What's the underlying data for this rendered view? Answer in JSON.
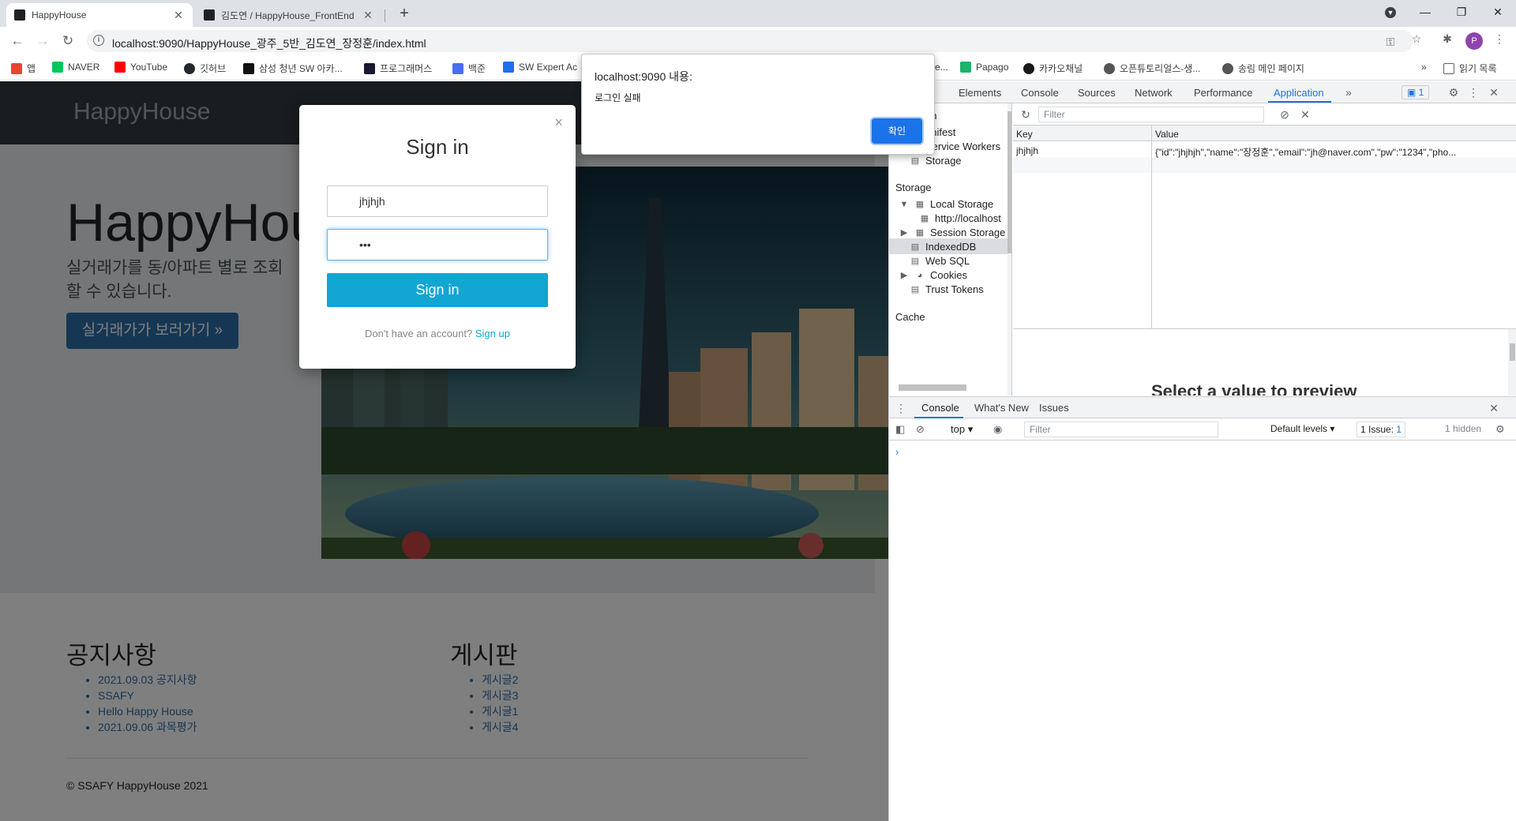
{
  "tabs": [
    {
      "title": "HappyHouse",
      "active": true
    },
    {
      "title": "김도연 / HappyHouse_FrontEnd",
      "active": false
    }
  ],
  "toolbar": {
    "url": "localhost:9090/HappyHouse_광주_5반_김도연_장정훈/index.html"
  },
  "bookmarks": {
    "items": [
      "앱",
      "NAVER",
      "YouTube",
      "깃허브",
      "삼성 청년 SW 아카...",
      "프로그래머스",
      "백준",
      "SW Expert Ac",
      "e...",
      "Papago",
      "카카오채널",
      "오픈튜토리얼스-생...",
      "송림 메인 페이지"
    ],
    "more": "»",
    "reading_list": "읽기 목록",
    "colors": [
      "#ea4335",
      "#03c75a",
      "#ff0000",
      "#24292e",
      "#111111",
      "#1a1a2e",
      "#4a6cf7",
      "#1f6feb",
      "#888888",
      "#1fb26b",
      "#191919",
      "#555555",
      "#555555"
    ]
  },
  "site": {
    "brand": "HappyHouse",
    "hero_title": "HappyHouse",
    "hero_text": "실거래가를 동/아파트 별로 조회할 수 있습니다.",
    "cta": "실거래가가 보러가기 »",
    "notice_title": "공지사항",
    "notices": [
      "2021.09.03 공지사항",
      "SSAFY",
      "Hello Happy House",
      "2021.09.06 과목평가"
    ],
    "board_title": "게시판",
    "posts": [
      "게시글2",
      "게시글3",
      "게시글1",
      "게시글4"
    ],
    "copyright": "© SSAFY HappyHouse 2021"
  },
  "modal": {
    "title": "Sign in",
    "close": "×",
    "id_value": "jhjhjh",
    "pw_value": "•••",
    "submit": "Sign in",
    "hint": "Don't have an account?",
    "signup": "Sign up"
  },
  "alert": {
    "title": "localhost:9090 내용:",
    "message": "로그인 실패",
    "ok": "확인"
  },
  "devtools": {
    "tabs": [
      "Elements",
      "Console",
      "Sources",
      "Network",
      "Performance",
      "Application"
    ],
    "active_tab": "Application",
    "issues_count": "1",
    "sidebar": {
      "app_items": [
        "on",
        "anifest",
        "Service Workers",
        "Storage"
      ],
      "storage_header": "Storage",
      "storage_items": [
        "Local Storage",
        "http://localhost",
        "Session Storage",
        "IndexedDB",
        "Web SQL",
        "Cookies",
        "Trust Tokens"
      ],
      "cache_header": "Cache"
    },
    "filter_placeholder": "Filter",
    "table": {
      "headers": [
        "Key",
        "Value"
      ],
      "rows": [
        {
          "key": "jhjhjh",
          "value": "{\"id\":\"jhjhjh\",\"name\":\"장정훈\",\"email\":\"jh@naver.com\",\"pw\":\"1234\",\"pho..."
        }
      ]
    },
    "preview_text": "Select a value to preview",
    "drawer_tabs": [
      "Console",
      "What's New",
      "Issues"
    ],
    "console": {
      "context": "top",
      "filter_placeholder": "Filter",
      "levels": "Default levels",
      "issue": "1 Issue:",
      "issue_count": "1",
      "hidden": "1 hidden",
      "prompt": "›"
    }
  }
}
